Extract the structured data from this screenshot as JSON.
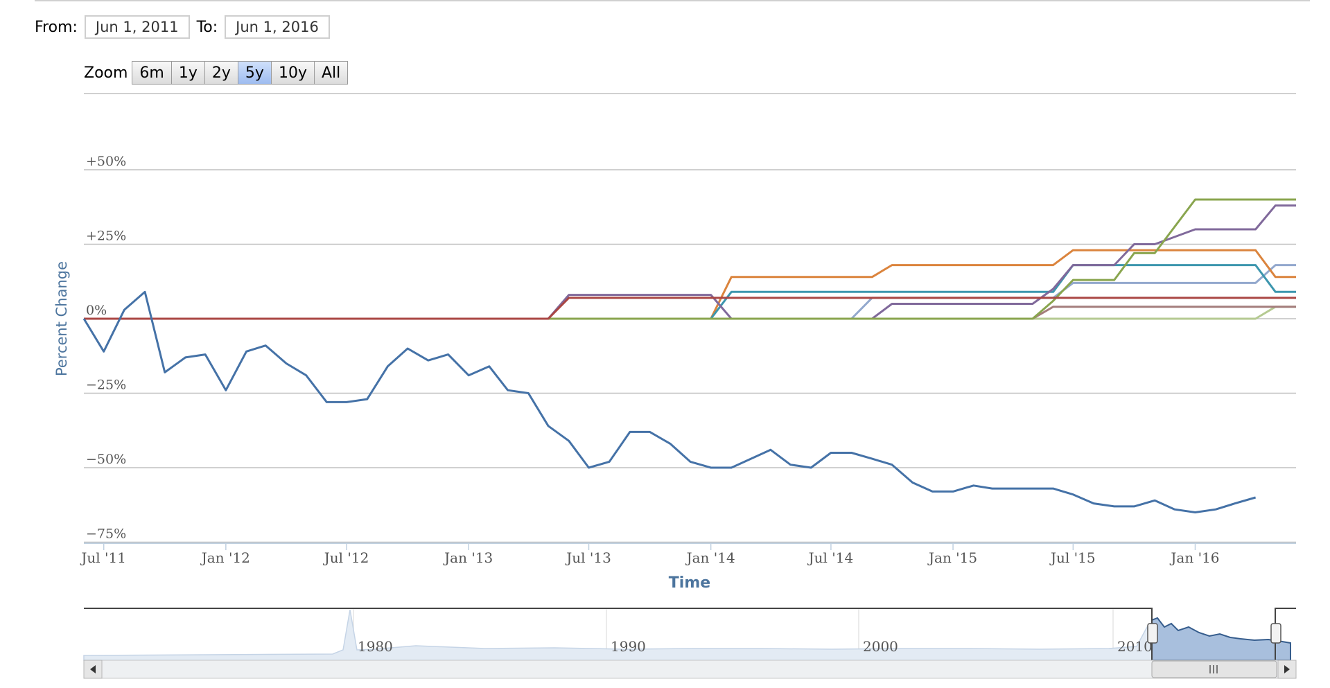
{
  "range": {
    "from_label": "From:",
    "from_value": "Jun 1, 2011",
    "to_label": "To:",
    "to_value": "Jun 1, 2016"
  },
  "zoom": {
    "label": "Zoom",
    "buttons": [
      "6m",
      "1y",
      "2y",
      "5y",
      "10y",
      "All"
    ],
    "active": "5y"
  },
  "colors": {
    "series": [
      "#4572a7",
      "#aa4643",
      "#89a54e",
      "#80699b",
      "#3d96ae",
      "#db843d",
      "#92a8cd",
      "#a47d7c",
      "#b5ca92"
    ],
    "grid": "#c0c0c0",
    "axis_text": "#4d759e",
    "navigator_fill": "#c9d6e6",
    "navigator_selected": "#a8bfdd"
  },
  "chart_data": {
    "type": "line",
    "ylabel": "Percent Change",
    "xlabel": "Time",
    "ylim": [
      -75,
      75
    ],
    "y_ticks": [
      50,
      25,
      0,
      -25,
      -50,
      -75
    ],
    "y_tick_labels": [
      "+50%",
      "+25%",
      "0%",
      "−25%",
      "−50%",
      "−75%"
    ],
    "x_ticks": [
      "2011-07-01",
      "2012-01-01",
      "2012-07-01",
      "2013-01-01",
      "2013-07-01",
      "2014-01-01",
      "2014-07-01",
      "2015-01-01",
      "2015-07-01",
      "2016-01-01"
    ],
    "x_tick_labels": [
      "Jul '11",
      "Jan '12",
      "Jul '12",
      "Jan '13",
      "Jul '13",
      "Jan '14",
      "Jul '14",
      "Jan '15",
      "Jul '15",
      "Jan '16"
    ],
    "x_range": [
      "2011-06-01",
      "2016-06-01"
    ],
    "series": [
      {
        "x": [
          "2011-06-01",
          "2011-07-01",
          "2011-08-01",
          "2011-09-01",
          "2011-10-01",
          "2011-11-01",
          "2011-12-01",
          "2012-01-01",
          "2012-02-01",
          "2012-03-01",
          "2012-04-01",
          "2012-05-01",
          "2012-06-01",
          "2012-07-01",
          "2012-08-01",
          "2012-09-01",
          "2012-10-01",
          "2012-11-01",
          "2012-12-01",
          "2013-01-01",
          "2013-02-01",
          "2013-03-01",
          "2013-04-01",
          "2013-05-01",
          "2013-06-01",
          "2013-07-01",
          "2013-08-01",
          "2013-09-01",
          "2013-10-01",
          "2013-11-01",
          "2013-12-01",
          "2014-01-01",
          "2014-02-01",
          "2014-04-01",
          "2014-05-01",
          "2014-06-01",
          "2014-07-01",
          "2014-08-01",
          "2014-09-01",
          "2014-10-01",
          "2014-11-01",
          "2014-12-01",
          "2015-01-01",
          "2015-02-01",
          "2015-03-01",
          "2015-04-01",
          "2015-05-01",
          "2015-06-01",
          "2015-07-01",
          "2015-08-01",
          "2015-09-01",
          "2015-10-01",
          "2015-11-01",
          "2015-12-01",
          "2016-01-01",
          "2016-02-01",
          "2016-03-01",
          "2016-04-01"
        ],
        "values": [
          0,
          -11,
          3,
          9,
          -18,
          -13,
          -12,
          -24,
          -11,
          -9,
          -15,
          -19,
          -28,
          -28,
          -27,
          -16,
          -10,
          -14,
          -12,
          -19,
          -16,
          -24,
          -25,
          -36,
          -41,
          -50,
          -48,
          -38,
          -38,
          -42,
          -48,
          -50,
          -50,
          -44,
          -49,
          -50,
          -45,
          -45,
          -47,
          -49,
          -55,
          -58,
          -58,
          -56,
          -57,
          -57,
          -57,
          -57,
          -59,
          -62,
          -63,
          -63,
          -61,
          -64,
          -65,
          -64,
          -62,
          -60
        ]
      },
      {
        "x": [
          "2011-06-01",
          "2013-05-01",
          "2013-06-01",
          "2015-12-01",
          "2016-06-01"
        ],
        "values": [
          0,
          0,
          7,
          7,
          7
        ]
      },
      {
        "x": [
          "2011-06-01",
          "2015-05-01",
          "2015-06-01",
          "2015-07-01",
          "2015-09-01",
          "2015-10-01",
          "2015-11-01",
          "2016-01-01",
          "2016-06-01"
        ],
        "values": [
          0,
          0,
          6,
          13,
          13,
          22,
          22,
          40,
          40
        ]
      },
      {
        "x": [
          "2011-06-01",
          "2013-05-01",
          "2013-06-01",
          "2014-01-01",
          "2014-02-01",
          "2014-09-01",
          "2014-10-01",
          "2015-05-01",
          "2015-06-01",
          "2015-07-01",
          "2015-09-01",
          "2015-10-01",
          "2015-11-01",
          "2016-01-01",
          "2016-04-01",
          "2016-05-01",
          "2016-06-01"
        ],
        "values": [
          0,
          0,
          8,
          8,
          0,
          0,
          5,
          5,
          10,
          18,
          18,
          25,
          25,
          30,
          30,
          38,
          38
        ]
      },
      {
        "x": [
          "2011-06-01",
          "2014-01-01",
          "2014-02-01",
          "2015-05-01",
          "2015-06-01",
          "2015-07-01",
          "2015-09-01",
          "2015-10-01",
          "2016-04-01",
          "2016-05-01",
          "2016-06-01"
        ],
        "values": [
          0,
          0,
          9,
          9,
          9,
          18,
          18,
          18,
          18,
          9,
          9
        ]
      },
      {
        "x": [
          "2011-06-01",
          "2014-01-01",
          "2014-02-01",
          "2014-09-01",
          "2014-10-01",
          "2015-05-01",
          "2015-06-01",
          "2015-07-01",
          "2015-09-01",
          "2016-04-01",
          "2016-05-01",
          "2016-06-01"
        ],
        "values": [
          0,
          0,
          14,
          14,
          18,
          18,
          18,
          23,
          23,
          23,
          14,
          14
        ]
      },
      {
        "x": [
          "2011-06-01",
          "2014-08-01",
          "2014-09-01",
          "2015-06-01",
          "2015-07-01",
          "2016-04-01",
          "2016-05-01",
          "2016-06-01"
        ],
        "values": [
          0,
          0,
          7,
          7,
          12,
          12,
          18,
          18
        ]
      },
      {
        "x": [
          "2011-06-01",
          "2015-05-01",
          "2015-06-01",
          "2016-06-01"
        ],
        "values": [
          0,
          0,
          4,
          4
        ]
      },
      {
        "x": [
          "2011-06-01",
          "2016-04-01",
          "2016-05-01",
          "2016-06-01"
        ],
        "values": [
          0,
          0,
          4,
          4
        ]
      }
    ]
  },
  "navigator": {
    "labels": [
      "1980",
      "1990",
      "2000",
      "2010"
    ]
  }
}
